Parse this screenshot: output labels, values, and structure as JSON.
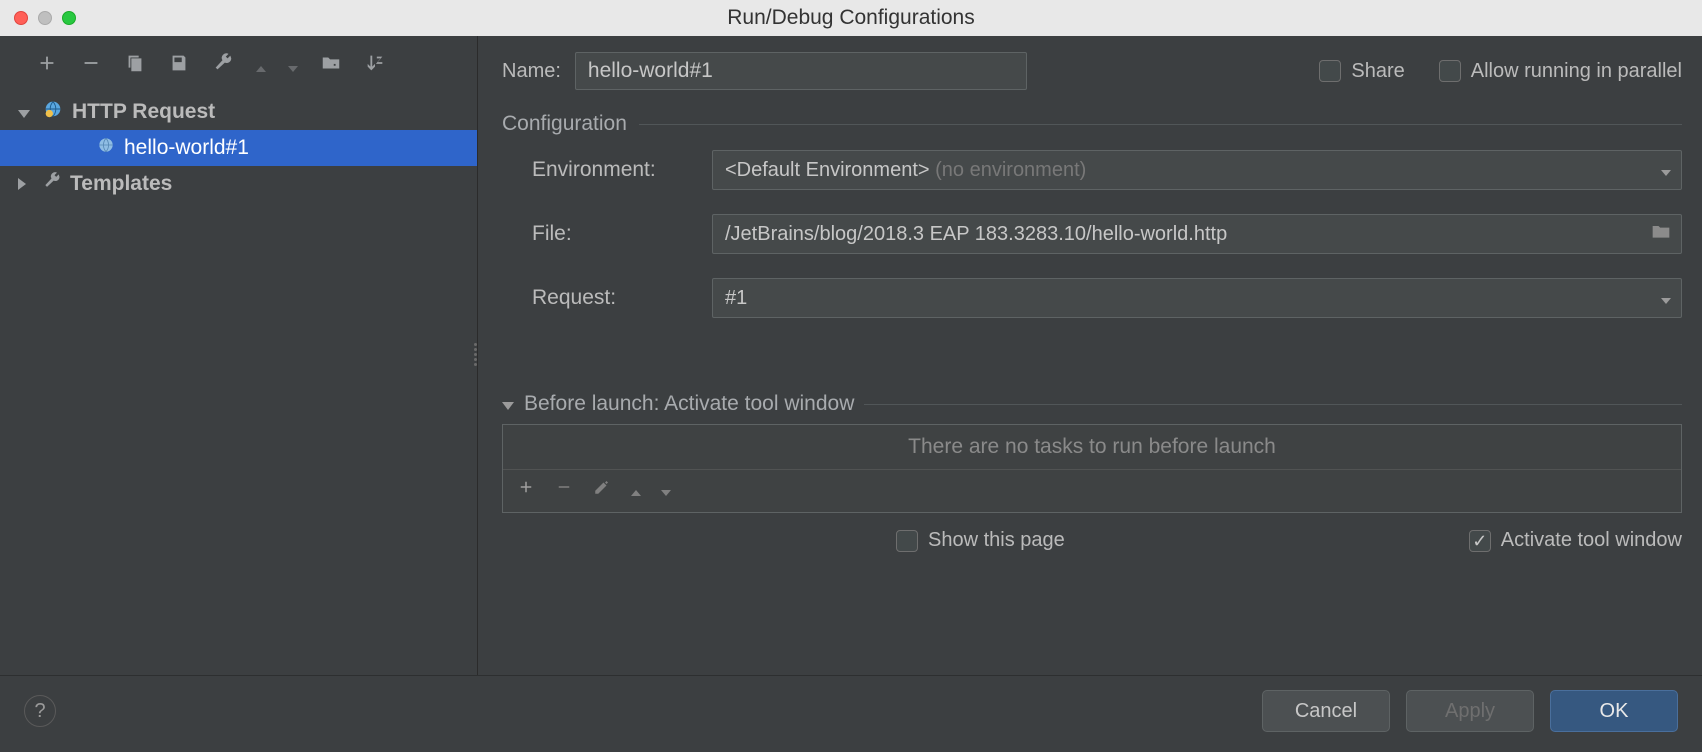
{
  "title": "Run/Debug Configurations",
  "toolbar": {
    "items": [
      "plus",
      "minus",
      "copy",
      "save",
      "wrench",
      "up",
      "down",
      "folder",
      "sort"
    ]
  },
  "tree": {
    "httpRequest": {
      "label": "HTTP Request",
      "expanded": true
    },
    "child": {
      "label": "hello-world#1"
    },
    "templates": {
      "label": "Templates",
      "expanded": false
    }
  },
  "form": {
    "name_label": "Name:",
    "name_value": "hello-world#1",
    "share_label": "Share",
    "allow_parallel_label": "Allow running in parallel",
    "config_section": "Configuration",
    "env_label": "Environment:",
    "env_value": "<Default Environment>",
    "env_hint": "(no environment)",
    "file_label": "File:",
    "file_value": "/JetBrains/blog/2018.3 EAP 183.3283.10/hello-world.http",
    "request_label": "Request:",
    "request_value": "#1"
  },
  "before": {
    "header": "Before launch: Activate tool window",
    "empty_text": "There are no tasks to run before launch",
    "show_page": "Show this page",
    "activate_tw": "Activate tool window"
  },
  "footer": {
    "cancel": "Cancel",
    "apply": "Apply",
    "ok": "OK"
  }
}
